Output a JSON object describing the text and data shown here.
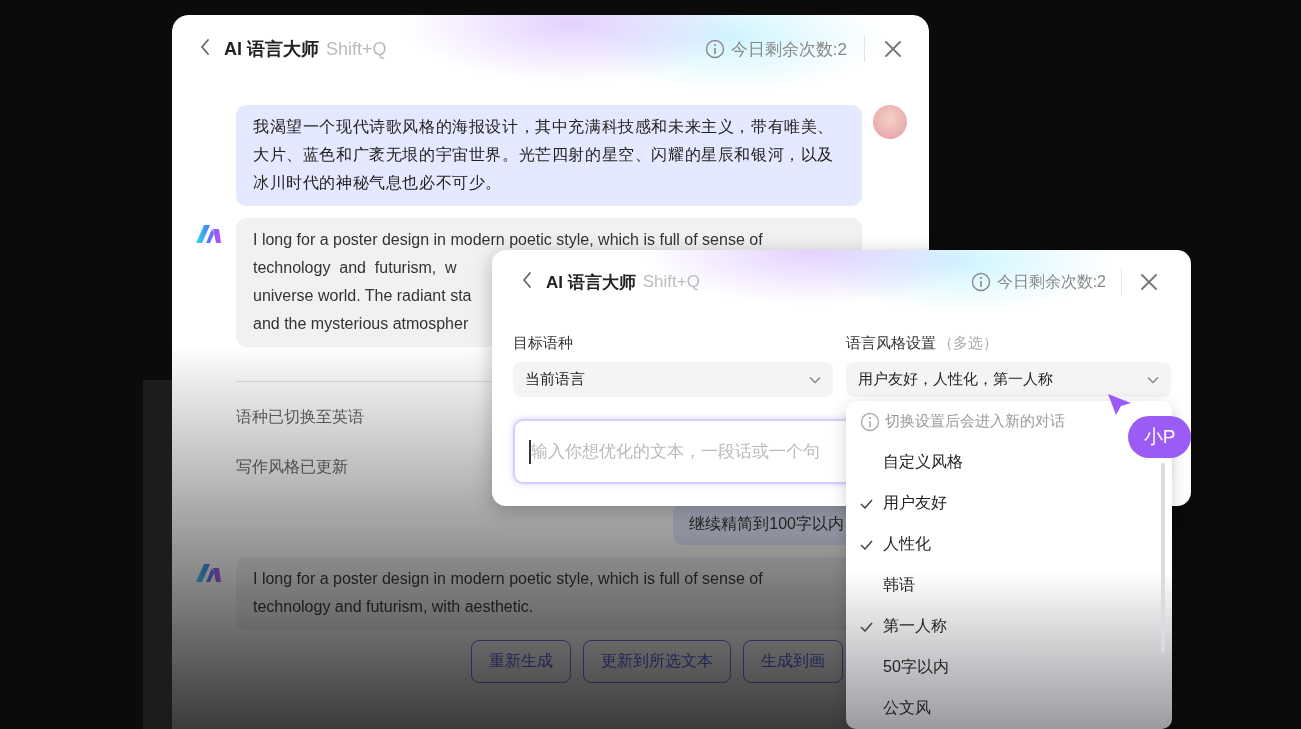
{
  "main_window": {
    "title": "AI 语言大师",
    "shortcut": "Shift+Q",
    "quota": "今日剩余次数:2",
    "messages": [
      {
        "kind": "user",
        "text": "我渴望一个现代诗歌风格的海报设计，其中充满科技感和未来主义，带有唯美、大片、蓝色和广袤无垠的宇宙世界。光芒四射的星空、闪耀的星辰和银河，以及冰川时代的神秘气息也必不可少。"
      },
      {
        "kind": "ai",
        "lines": [
          "I long for a poster design in modern poetic style, which is full of sense of",
          "technology  and  futurism,  w",
          "universe world. The radiant sta",
          "and the mysterious atmospher"
        ]
      },
      {
        "kind": "notice",
        "text": "语种已切换至英语"
      },
      {
        "kind": "notice",
        "text": "写作风格已更新"
      },
      {
        "kind": "user",
        "text": "继续精简到100字以内"
      },
      {
        "kind": "ai",
        "lines": [
          "I long for a poster design in modern poetic style, which is full of sense of",
          "technology and futurism, with aesthetic."
        ],
        "actions": [
          "重新生成",
          "更新到所选文本",
          "生成到画"
        ]
      }
    ]
  },
  "tool_window": {
    "title": "AI 语言大师",
    "shortcut": "Shift+Q",
    "quota": "今日剩余次数:2",
    "target_language": {
      "label": "目标语种",
      "value": "当前语言"
    },
    "style_setting": {
      "label": "语言风格设置",
      "note": "（多选）",
      "value": "用户友好，人性化，第一人称"
    },
    "input": {
      "placeholder": "输入你想优化的文本，一段话或一个句"
    }
  },
  "style_dropdown": {
    "hint": "切换设置后会进入新的对话",
    "options": [
      {
        "label": "自定义风格",
        "checked": false
      },
      {
        "label": "用户友好",
        "checked": true
      },
      {
        "label": "人性化",
        "checked": true
      },
      {
        "label": "韩语",
        "checked": false
      },
      {
        "label": "第一人称",
        "checked": true
      },
      {
        "label": "50字以内",
        "checked": false
      },
      {
        "label": "公文风",
        "checked": false
      }
    ]
  },
  "cursor_badge": {
    "label": "小P"
  }
}
